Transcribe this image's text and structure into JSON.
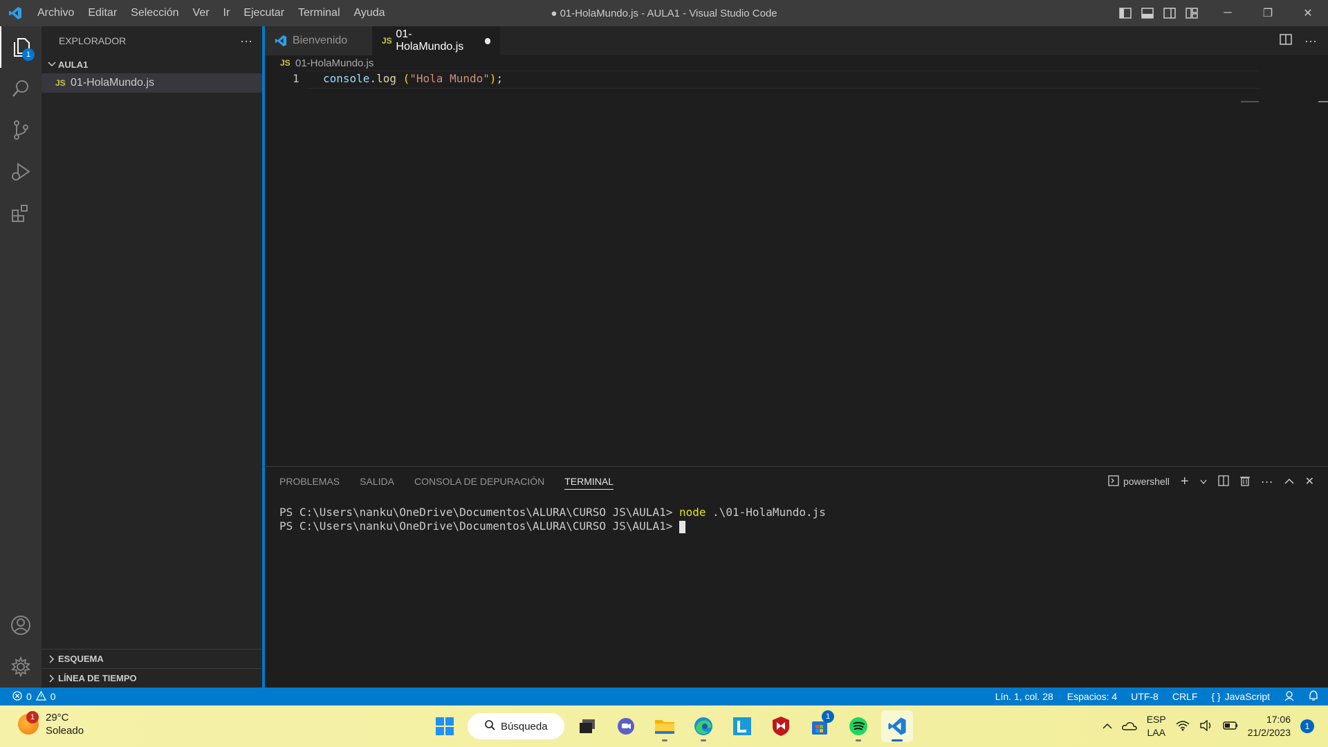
{
  "window": {
    "title": "● 01-HolaMundo.js - AULA1 - Visual Studio Code",
    "menu": [
      "Archivo",
      "Editar",
      "Selección",
      "Ver",
      "Ir",
      "Ejecutar",
      "Terminal",
      "Ayuda"
    ]
  },
  "activity_bar": {
    "explorer_badge": "1",
    "items": [
      "explorer-icon",
      "search-icon",
      "source-control-icon",
      "run-debug-icon",
      "extensions-icon"
    ],
    "bottom": [
      "account-icon",
      "gear-icon"
    ]
  },
  "sidebar": {
    "title": "EXPLORADOR",
    "more": "···",
    "folder": "AULA1",
    "files": [
      {
        "badge": "JS",
        "name": "01-HolaMundo.js"
      }
    ],
    "outline": "ESQUEMA",
    "timeline": "LÍNEA DE TIEMPO"
  },
  "tabs": [
    {
      "label": "Bienvenido",
      "active": false
    },
    {
      "badge": "JS",
      "label": "01-HolaMundo.js",
      "active": true,
      "dirty": true
    }
  ],
  "breadcrumb": {
    "badge": "JS",
    "file": "01-HolaMundo.js"
  },
  "code": {
    "line_number": "1",
    "tokens": {
      "obj": "console",
      "dot": ".",
      "fn": "log",
      "space": " ",
      "open": "(",
      "str": "\"Hola Mundo\"",
      "close": ")",
      "semi": ";"
    }
  },
  "panel": {
    "tabs": [
      "PROBLEMAS",
      "SALIDA",
      "CONSOLA DE DEPURACIÓN",
      "TERMINAL"
    ],
    "active_tab": "TERMINAL",
    "shell": "powershell",
    "terminal": {
      "prompt1": "PS C:\\Users\\nanku\\OneDrive\\Documentos\\ALURA\\CURSO JS\\AULA1> ",
      "cmd1": "node",
      "arg1": " .\\01-HolaMundo.js",
      "prompt2": "PS C:\\Users\\nanku\\OneDrive\\Documentos\\ALURA\\CURSO JS\\AULA1> "
    }
  },
  "statusbar": {
    "errors": "0",
    "warnings": "0",
    "position": "Lín. 1, col. 28",
    "spaces": "Espacios: 4",
    "encoding": "UTF-8",
    "eol": "CRLF",
    "language": "JavaScript"
  },
  "taskbar": {
    "weather": {
      "temp": "29°C",
      "condition": "Soleado",
      "badge": "1"
    },
    "search": "Búsqueda",
    "store_badge": "1",
    "tray": {
      "lang1": "ESP",
      "lang2": "LAA",
      "time": "17:06",
      "date": "21/2/2023",
      "notifications": "1"
    }
  },
  "colors": {
    "accent": "#007acc",
    "titlebar": "#3c3c3c",
    "editor": "#1e1e1e",
    "taskbar": "#f3f0a0"
  }
}
